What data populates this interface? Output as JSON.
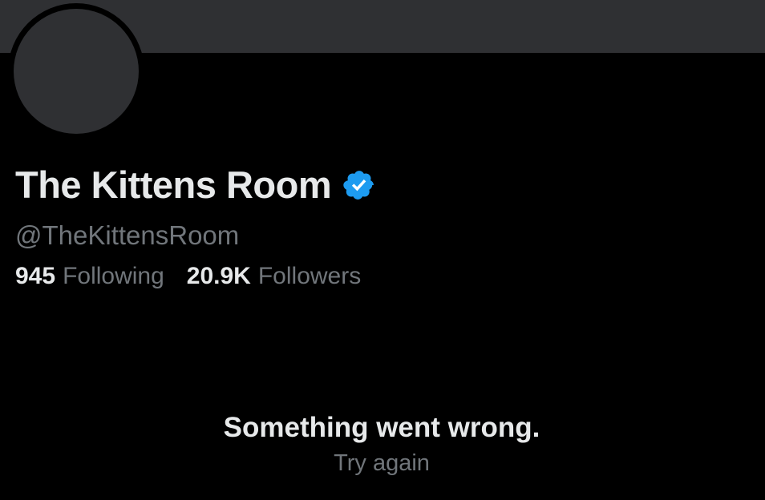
{
  "profile": {
    "display_name": "The Kittens Room",
    "verified_icon": "verified-badge-icon",
    "handle": "@TheKittensRoom"
  },
  "stats": {
    "following_count": "945",
    "following_label": "Following",
    "followers_count": "20.9K",
    "followers_label": "Followers"
  },
  "error": {
    "message": "Something went wrong.",
    "retry_label": "Try again"
  },
  "colors": {
    "background": "#000000",
    "banner": "#2f3033",
    "primary_text": "#e7e9ea",
    "secondary_text": "#71767b",
    "verified_blue": "#1d9bf0"
  }
}
